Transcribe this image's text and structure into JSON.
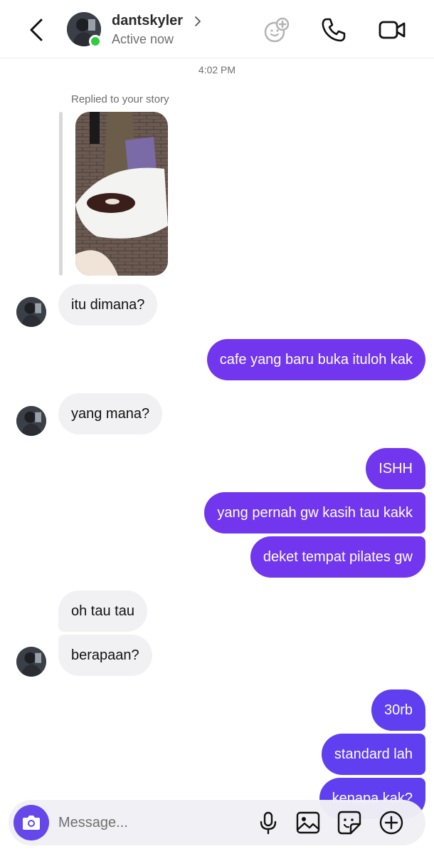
{
  "header": {
    "username": "dantskyler",
    "status": "Active now",
    "icons": [
      "back-icon",
      "effects-icon",
      "phone-icon",
      "video-camera-icon"
    ]
  },
  "chat": {
    "timestamp": "4:02 PM",
    "story_reply_label": "Replied to your story",
    "messages": [
      {
        "from": "them",
        "text": "itu dimana?"
      },
      {
        "from": "me",
        "text": "cafe yang baru buka ituloh kak"
      },
      {
        "from": "them",
        "text": "yang mana?"
      },
      {
        "from": "me",
        "text": "ISHH"
      },
      {
        "from": "me",
        "text": "yang pernah gw kasih tau kakk"
      },
      {
        "from": "me",
        "text": "deket tempat pilates gw"
      },
      {
        "from": "them",
        "text": "oh tau tau"
      },
      {
        "from": "them",
        "text": "berapaan?"
      },
      {
        "from": "me",
        "text": "30rb"
      },
      {
        "from": "me",
        "text": "standard lah"
      },
      {
        "from": "me",
        "text": "kenapa kak?"
      }
    ]
  },
  "composer": {
    "placeholder": "Message...",
    "icons": [
      "camera-icon",
      "microphone-icon",
      "gallery-icon",
      "sticker-icon",
      "plus-icon"
    ]
  },
  "colors": {
    "sent_bubble": "#7236ee",
    "sent_bubble_bottom": "#5f3ff0",
    "received_bubble": "#f1f1f3",
    "online": "#2ecc40"
  }
}
